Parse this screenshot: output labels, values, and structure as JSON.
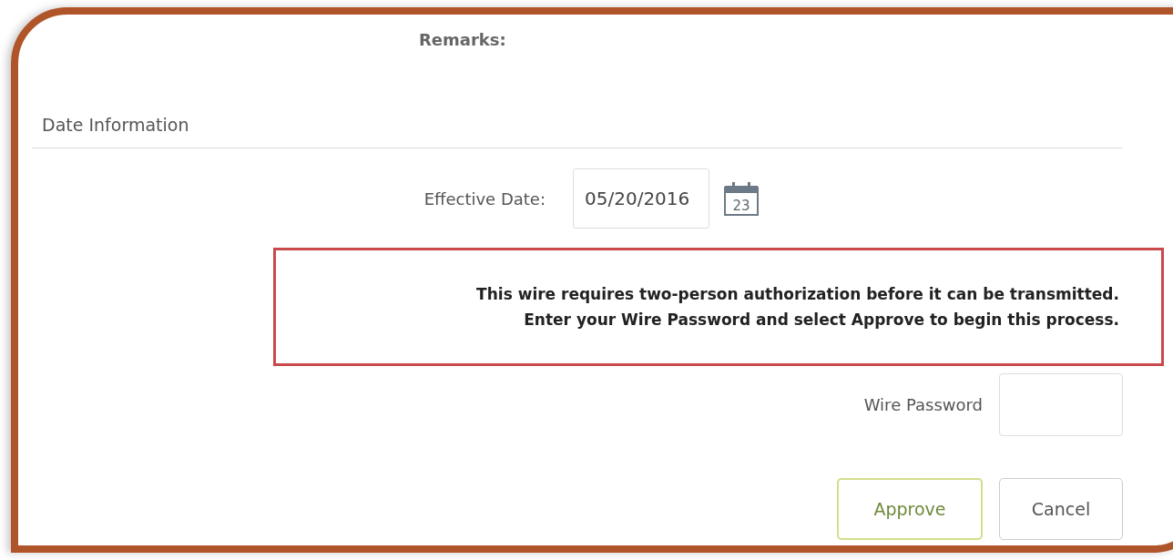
{
  "remarks": {
    "label": "Remarks:"
  },
  "section": {
    "title": "Date Information"
  },
  "effective_date": {
    "label": "Effective Date:",
    "value": "05/20/2016",
    "calendar_day": "23"
  },
  "notice": {
    "lines": [
      "This wire requires two-person authorization before it can be transmitted.",
      "Enter your Wire Password and select Approve to begin this process."
    ]
  },
  "wire_password": {
    "label": "Wire Password"
  },
  "buttons": [
    {
      "label": "Approve",
      "kind": "primary"
    },
    {
      "label": "Cancel",
      "kind": "default"
    }
  ]
}
